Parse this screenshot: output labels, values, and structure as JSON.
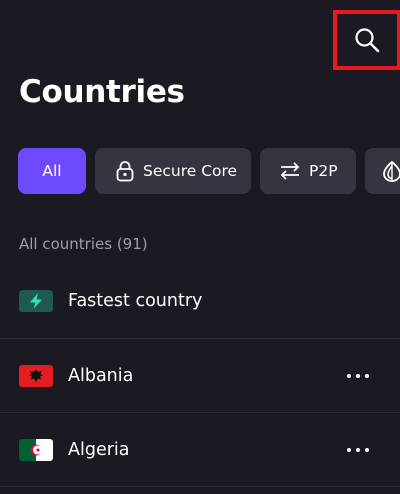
{
  "header": {
    "title": "Countries",
    "search_icon": "search-icon"
  },
  "filters": [
    {
      "label": "All",
      "active": true,
      "icon": ""
    },
    {
      "label": "Secure Core",
      "active": false,
      "icon": "lock-icon"
    },
    {
      "label": "P2P",
      "active": false,
      "icon": "transfer-arrows-icon"
    },
    {
      "label": "",
      "active": false,
      "icon": "tor-onion-icon"
    }
  ],
  "list": {
    "header": "All countries (91)",
    "items": [
      {
        "label": "Fastest country",
        "icon": "bolt-icon",
        "has_menu": false
      },
      {
        "label": "Albania",
        "icon": "flag-albania-icon",
        "has_menu": true
      },
      {
        "label": "Algeria",
        "icon": "flag-algeria-icon",
        "has_menu": true
      }
    ]
  },
  "colors": {
    "background": "#1b1a23",
    "accent": "#6d4aff",
    "chip": "#35343f",
    "secondary_text": "#9e9daa",
    "highlight_box": "#e8191c",
    "fastest_badge": "#1e5a4f",
    "fastest_bolt": "#2ee6b4"
  }
}
